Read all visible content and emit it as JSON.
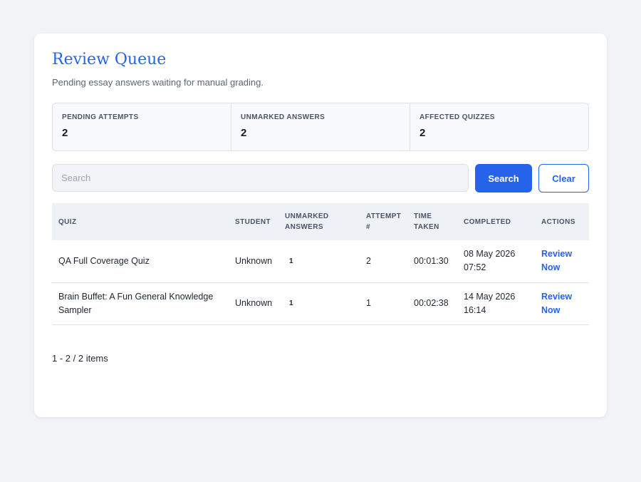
{
  "page": {
    "title": "Review Queue",
    "subtitle": "Pending essay answers waiting for manual grading."
  },
  "stats": [
    {
      "label": "PENDING ATTEMPTS",
      "value": "2"
    },
    {
      "label": "UNMARKED ANSWERS",
      "value": "2"
    },
    {
      "label": "AFFECTED QUIZZES",
      "value": "2"
    }
  ],
  "search": {
    "placeholder": "Search",
    "value": "",
    "search_label": "Search",
    "clear_label": "Clear"
  },
  "table": {
    "headers": {
      "quiz": "QUIZ",
      "student": "STUDENT",
      "unmarked": "UNMARKED ANSWERS",
      "attempt": "ATTEMPT #",
      "time": "TIME TAKEN",
      "completed": "COMPLETED",
      "actions": "ACTIONS"
    },
    "rows": [
      {
        "quiz": "QA Full Coverage Quiz",
        "student": "Unknown",
        "unmarked": "1",
        "attempt": "2",
        "time": "00:01:30",
        "completed": "08 May 2026 07:52",
        "action": "Review Now"
      },
      {
        "quiz": "Brain Buffet: A Fun General Knowledge Sampler",
        "student": "Unknown",
        "unmarked": "1",
        "attempt": "1",
        "time": "00:02:38",
        "completed": "14 May 2026 16:14",
        "action": "Review Now"
      }
    ]
  },
  "pagination": {
    "text": "1 - 2 / 2 items"
  },
  "colors": {
    "accent": "#2563eb",
    "background": "#f1f3f7",
    "card": "#ffffff"
  }
}
